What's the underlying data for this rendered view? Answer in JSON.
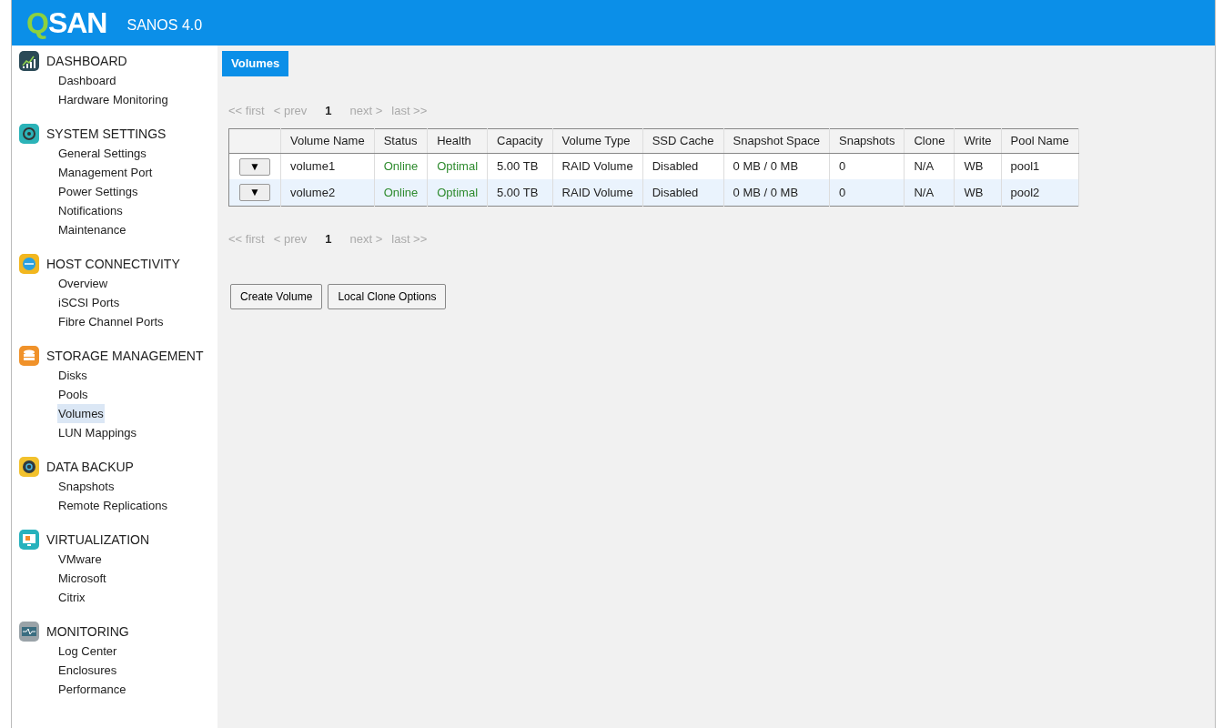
{
  "header": {
    "logo": "QSAN",
    "product": "SANOS 4.0"
  },
  "sidebar": {
    "sections": [
      {
        "title": "DASHBOARD",
        "color": "#2b4a57",
        "items": [
          {
            "label": "Dashboard",
            "selected": false
          },
          {
            "label": "Hardware Monitoring",
            "selected": false
          }
        ]
      },
      {
        "title": "SYSTEM SETTINGS",
        "color": "#2bb3b8",
        "items": [
          {
            "label": "General Settings",
            "selected": false
          },
          {
            "label": "Management Port",
            "selected": false
          },
          {
            "label": "Power Settings",
            "selected": false
          },
          {
            "label": "Notifications",
            "selected": false
          },
          {
            "label": "Maintenance",
            "selected": false
          }
        ]
      },
      {
        "title": "HOST CONNECTIVITY",
        "color": "#f2b71f",
        "items": [
          {
            "label": "Overview",
            "selected": false
          },
          {
            "label": "iSCSI Ports",
            "selected": false
          },
          {
            "label": "Fibre Channel Ports",
            "selected": false
          }
        ]
      },
      {
        "title": "STORAGE MANAGEMENT",
        "color": "#f0922a",
        "items": [
          {
            "label": "Disks",
            "selected": false
          },
          {
            "label": "Pools",
            "selected": false
          },
          {
            "label": "Volumes",
            "selected": true
          },
          {
            "label": "LUN Mappings",
            "selected": false
          }
        ]
      },
      {
        "title": "DATA BACKUP",
        "color": "#f2c12c",
        "items": [
          {
            "label": "Snapshots",
            "selected": false
          },
          {
            "label": "Remote Replications",
            "selected": false
          }
        ]
      },
      {
        "title": "VIRTUALIZATION",
        "color": "#27b2bd",
        "items": [
          {
            "label": "VMware",
            "selected": false
          },
          {
            "label": "Microsoft",
            "selected": false
          },
          {
            "label": "Citrix",
            "selected": false
          }
        ]
      },
      {
        "title": "MONITORING",
        "color": "#9aa3a8",
        "items": [
          {
            "label": "Log Center",
            "selected": false
          },
          {
            "label": "Enclosures",
            "selected": false
          },
          {
            "label": "Performance",
            "selected": false
          }
        ]
      }
    ]
  },
  "tabs": [
    {
      "label": "Volumes",
      "selected": true
    }
  ],
  "pagination_top": [
    {
      "label": "<< first",
      "disabled": true,
      "current": false
    },
    {
      "label": "< prev",
      "disabled": true,
      "current": false
    },
    {
      "label": "1",
      "disabled": false,
      "current": true
    },
    {
      "label": "next >",
      "disabled": true,
      "current": false
    },
    {
      "label": "last >>",
      "disabled": true,
      "current": false
    }
  ],
  "table": {
    "columns": [
      "",
      "Volume Name",
      "Status",
      "Health",
      "Capacity",
      "Volume Type",
      "SSD Cache",
      "Snapshot Space",
      "Snapshots",
      "Clone",
      "Write",
      "Pool Name"
    ],
    "rows": [
      {
        "selected": false,
        "cells": [
          {
            "text": "▼",
            "kind": "menu"
          },
          {
            "text": "volume1",
            "kind": "plain"
          },
          {
            "text": "Online",
            "kind": "good"
          },
          {
            "text": "Optimal",
            "kind": "good"
          },
          {
            "text": "5.00 TB",
            "kind": "plain"
          },
          {
            "text": "RAID Volume",
            "kind": "plain"
          },
          {
            "text": "Disabled",
            "kind": "plain"
          },
          {
            "text": "0 MB / 0 MB",
            "kind": "plain"
          },
          {
            "text": "0",
            "kind": "plain"
          },
          {
            "text": "N/A",
            "kind": "plain"
          },
          {
            "text": "WB",
            "kind": "plain"
          },
          {
            "text": "pool1",
            "kind": "plain"
          }
        ]
      },
      {
        "selected": true,
        "cells": [
          {
            "text": "▼",
            "kind": "menu"
          },
          {
            "text": "volume2",
            "kind": "plain"
          },
          {
            "text": "Online",
            "kind": "good"
          },
          {
            "text": "Optimal",
            "kind": "good"
          },
          {
            "text": "5.00 TB",
            "kind": "plain"
          },
          {
            "text": "RAID Volume",
            "kind": "plain"
          },
          {
            "text": "Disabled",
            "kind": "plain"
          },
          {
            "text": "0 MB / 0 MB",
            "kind": "plain"
          },
          {
            "text": "0",
            "kind": "plain"
          },
          {
            "text": "N/A",
            "kind": "plain"
          },
          {
            "text": "WB",
            "kind": "plain"
          },
          {
            "text": "pool2",
            "kind": "plain"
          }
        ]
      }
    ]
  },
  "pagination_bottom": [
    {
      "label": "<< first",
      "disabled": true,
      "current": false
    },
    {
      "label": "< prev",
      "disabled": true,
      "current": false
    },
    {
      "label": "1",
      "disabled": false,
      "current": true
    },
    {
      "label": "next >",
      "disabled": true,
      "current": false
    },
    {
      "label": "last >>",
      "disabled": true,
      "current": false
    }
  ],
  "buttons": [
    "Create Volume",
    "Local Clone Options"
  ]
}
